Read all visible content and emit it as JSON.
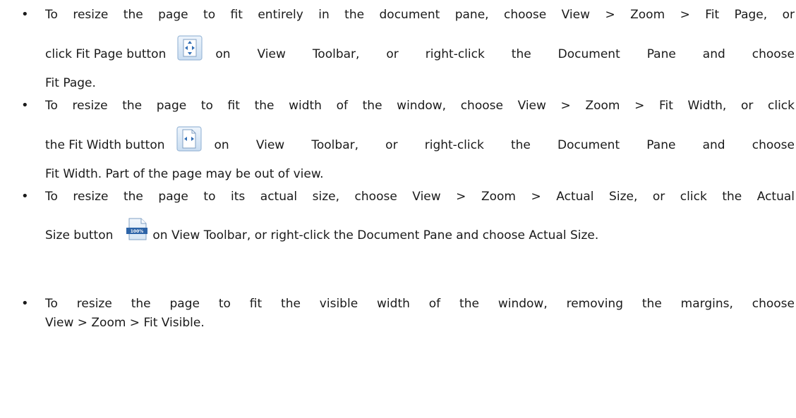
{
  "bullets": [
    {
      "lines": [
        "To resize the page to fit entirely in the document pane, choose View > Zoom > Fit Page, or",
        "click Fit Page button",
        "on View Toolbar, or right-click the Document Pane and choose",
        "Fit Page."
      ],
      "icon": "fit-page-icon"
    },
    {
      "lines": [
        "To resize the page to fit the width of the window, choose View > Zoom > Fit Width, or click",
        "the Fit Width button",
        "on View Toolbar, or right-click the Document Pane and choose",
        "Fit Width. Part of the page may be out of view."
      ],
      "icon": "fit-width-icon"
    },
    {
      "lines": [
        "To resize the page to its actual size, choose View > Zoom > Actual Size, or click the Actual",
        "Size button",
        "on View Toolbar, or right-click the Document Pane and choose Actual Size."
      ],
      "icon": "actual-size-icon",
      "icon_label": "100%"
    },
    {
      "lines": [
        "To resize the page to fit the visible width of the window, removing the margins, choose",
        "View > Zoom > Fit Visible."
      ]
    }
  ],
  "bullet_char": "•"
}
